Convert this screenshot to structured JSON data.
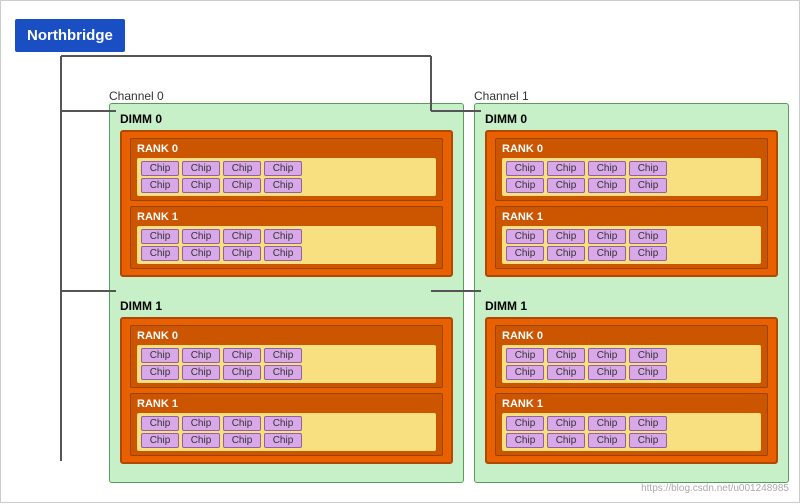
{
  "northbridge": {
    "label": "Northbridge"
  },
  "channels": [
    {
      "id": "channel0",
      "label": "Channel 0",
      "dimms": [
        {
          "id": "dimm0",
          "label": "DIMM 0",
          "ranks": [
            {
              "label": "RANK 0",
              "rows": [
                [
                  "Chip",
                  "Chip",
                  "Chip",
                  "Chip"
                ],
                [
                  "Chip",
                  "Chip",
                  "Chip",
                  "Chip"
                ]
              ]
            },
            {
              "label": "RANK 1",
              "rows": [
                [
                  "Chip",
                  "Chip",
                  "Chip",
                  "Chip"
                ],
                [
                  "Chip",
                  "Chip",
                  "Chip",
                  "Chip"
                ]
              ]
            }
          ]
        },
        {
          "id": "dimm1",
          "label": "DIMM 1",
          "ranks": [
            {
              "label": "RANK 0",
              "rows": [
                [
                  "Chip",
                  "Chip",
                  "Chip",
                  "Chip"
                ],
                [
                  "Chip",
                  "Chip",
                  "Chip",
                  "Chip"
                ]
              ]
            },
            {
              "label": "RANK 1",
              "rows": [
                [
                  "Chip",
                  "Chip",
                  "Chip",
                  "Chip"
                ],
                [
                  "Chip",
                  "Chip",
                  "Chip",
                  "Chip"
                ]
              ]
            }
          ]
        }
      ]
    },
    {
      "id": "channel1",
      "label": "Channel 1",
      "dimms": [
        {
          "id": "dimm0",
          "label": "DIMM 0",
          "ranks": [
            {
              "label": "RANK 0",
              "rows": [
                [
                  "Chip",
                  "Chip",
                  "Chip",
                  "Chip"
                ],
                [
                  "Chip",
                  "Chip",
                  "Chip",
                  "Chip"
                ]
              ]
            },
            {
              "label": "RANK 1",
              "rows": [
                [
                  "Chip",
                  "Chip",
                  "Chip",
                  "Chip"
                ],
                [
                  "Chip",
                  "Chip",
                  "Chip",
                  "Chip"
                ]
              ]
            }
          ]
        },
        {
          "id": "dimm1",
          "label": "DIMM 1",
          "ranks": [
            {
              "label": "RANK 0",
              "rows": [
                [
                  "Chip",
                  "Chip",
                  "Chip",
                  "Chip"
                ],
                [
                  "Chip",
                  "Chip",
                  "Chip",
                  "Chip"
                ]
              ]
            },
            {
              "label": "RANK 1",
              "rows": [
                [
                  "Chip",
                  "Chip",
                  "Chip",
                  "Chip"
                ],
                [
                  "Chip",
                  "Chip",
                  "Chip",
                  "Chip"
                ]
              ]
            }
          ]
        }
      ]
    }
  ],
  "watermark": "https://blog.csdn.net/u001248985"
}
